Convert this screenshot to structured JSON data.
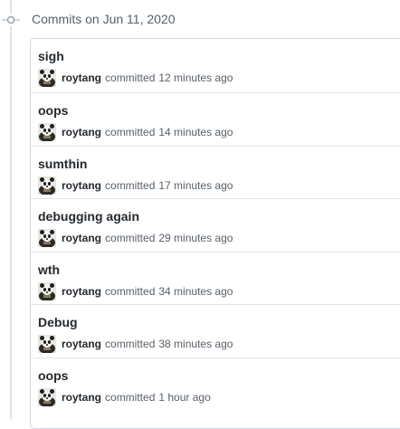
{
  "header": {
    "title": "Commits on Jun 11, 2020"
  },
  "commits": [
    {
      "title": "sigh",
      "author": "roytang",
      "verb": "committed",
      "time": "12 minutes ago"
    },
    {
      "title": "oops",
      "author": "roytang",
      "verb": "committed",
      "time": "14 minutes ago"
    },
    {
      "title": "sumthin",
      "author": "roytang",
      "verb": "committed",
      "time": "17 minutes ago"
    },
    {
      "title": "debugging again",
      "author": "roytang",
      "verb": "committed",
      "time": "29 minutes ago"
    },
    {
      "title": "wth",
      "author": "roytang",
      "verb": "committed",
      "time": "34 minutes ago"
    },
    {
      "title": "Debug",
      "author": "roytang",
      "verb": "committed",
      "time": "38 minutes ago"
    },
    {
      "title": "oops",
      "author": "roytang",
      "verb": "committed",
      "time": "1 hour ago"
    }
  ],
  "icons": {
    "commit": "git-commit-icon",
    "avatar": "panda-avatar-icon"
  }
}
